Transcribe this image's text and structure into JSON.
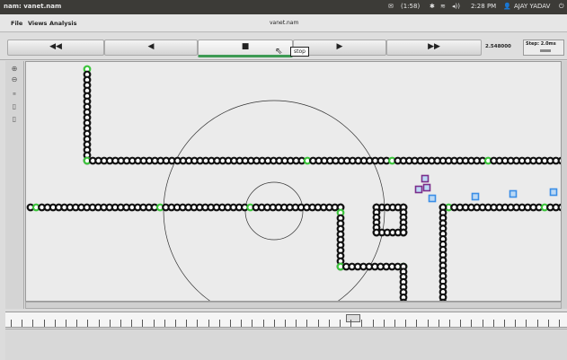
{
  "window": {
    "title": "nam: vanet.nam",
    "filename": "vanet.nam"
  },
  "system_tray": {
    "battery": "(1:58)",
    "time": "2:28 PM",
    "user": "AJAY YADAV"
  },
  "menu": {
    "file": "File",
    "views": "Views",
    "analysis": "Analysis"
  },
  "controls": {
    "rewind_fast": "◀◀",
    "rewind": "◀",
    "stop": "■",
    "play": "▶",
    "fast_forward": "▶▶",
    "tooltip": "stop",
    "time": "2.548000",
    "step": "Step: 2.0ms"
  },
  "icons": {
    "zoom_in": "zoom-in-icon",
    "zoom_out": "zoom-out-icon"
  },
  "colors": {
    "road_node": "#111111",
    "green_node": "#3cc43c",
    "vehicle_purple": "#7b2d8b",
    "vehicle_blue": "#3a8ee6"
  }
}
